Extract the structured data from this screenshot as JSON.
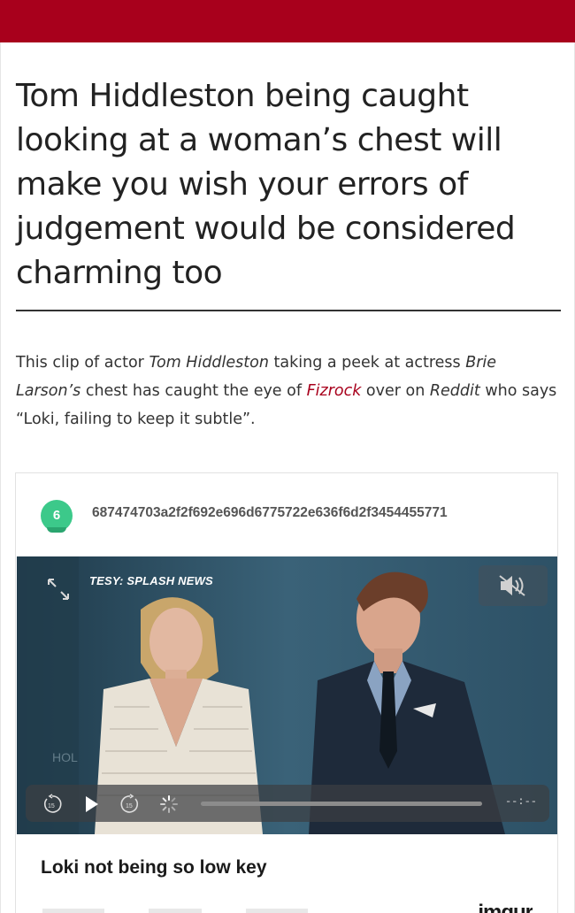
{
  "header": {
    "brand_color": "#a8001c"
  },
  "article": {
    "headline": "Tom Hiddleston being caught looking at a woman’s chest will make you wish your errors of judgement would be considered charming too",
    "intro": {
      "t1": "This clip of actor ",
      "actor": "Tom Hiddleston",
      "t2": " taking a peek at actress ",
      "actress": "Brie Larson’s",
      "t3": " chest has caught the eye of ",
      "user_link": "Fizrock",
      "t4": " over on ",
      "site": "Reddit",
      "t5": " who says “Loki, failing to keep it subtle”."
    }
  },
  "embed": {
    "score": "6",
    "score_color": "#3cc98a",
    "post_id": "687474703a2f2f692e696d6775722e636f6d2f3454455771",
    "video": {
      "watermark": "TESY: SPLASH NEWS",
      "time_display": "--:--",
      "icons": [
        "expand-icon",
        "mute-icon",
        "rewind-15-icon",
        "play-icon",
        "forward-15-icon",
        "loading-spinner-icon"
      ]
    },
    "caption": "Loki not being so low key",
    "logo_text": "imgur"
  }
}
